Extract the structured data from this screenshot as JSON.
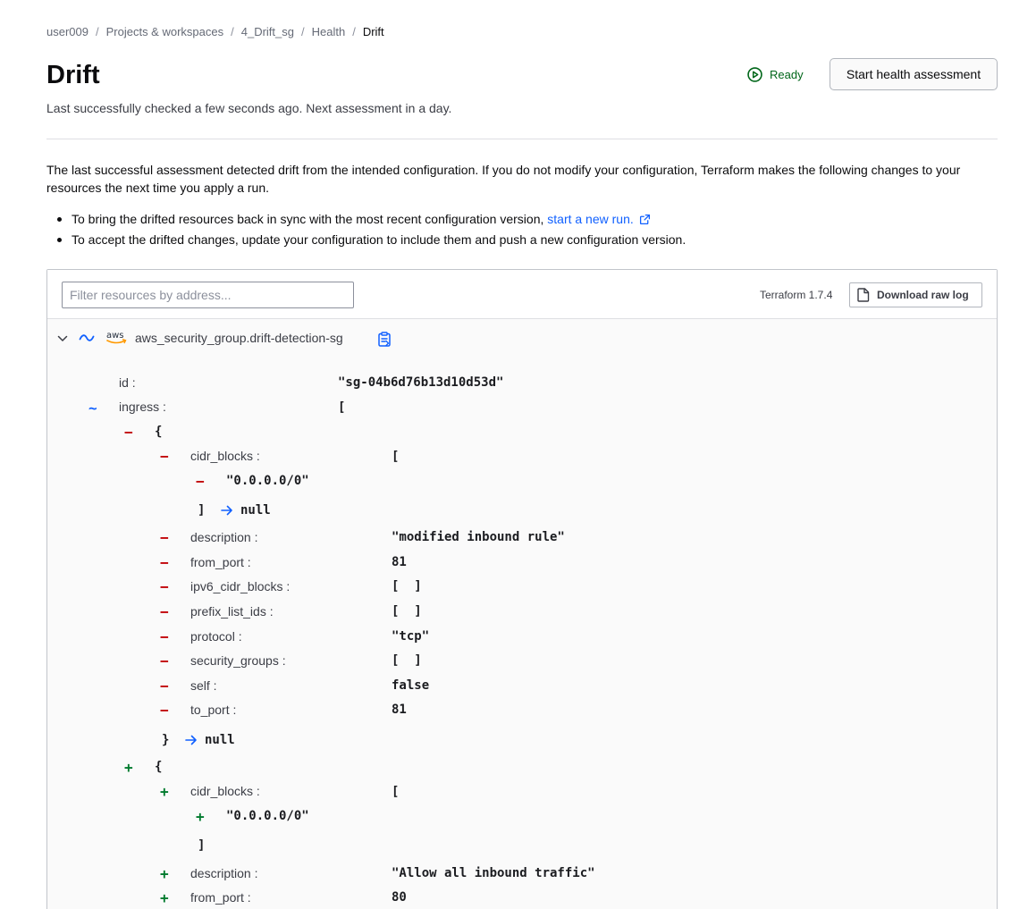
{
  "breadcrumb": {
    "items": [
      "user009",
      "Projects & workspaces",
      "4_Drift_sg",
      "Health",
      "Drift"
    ],
    "separator": "/"
  },
  "header": {
    "title": "Drift",
    "subtitle": "Last successfully checked a few seconds ago. Next assessment in a day.",
    "status_label": "Ready",
    "status_icon": "play-circle-icon",
    "start_button": "Start health assessment"
  },
  "intro": {
    "text": "The last successful assessment detected drift from the intended configuration. If you do not modify your configuration, Terraform makes the following changes to your resources the next time you apply a run.",
    "bullet1_text": "To bring the drifted resources back in sync with the most recent configuration version, ",
    "bullet1_link": "start a new run.",
    "bullet2_text": "To accept the drifted changes, update your configuration to include them and push a new configuration version."
  },
  "panel": {
    "filter_placeholder": "Filter resources by address...",
    "terraform_version": "Terraform 1.7.4",
    "download_button": "Download raw log",
    "resource": {
      "name": "aws_security_group.drift-detection-sg",
      "provider": "aws",
      "change_symbol": "~"
    }
  },
  "diff": {
    "id_key": "id :",
    "id_val": "\"sg-04b6d76b13d10d53d\"",
    "ingress_key": "ingress :",
    "open_bracket": "[",
    "close_bracket": "]",
    "open_brace": "{",
    "close_brace": "}",
    "empty_list": "[  ]",
    "null": "null",
    "minus": "−",
    "plus": "+",
    "tilde": "~",
    "removed": {
      "cidr_key": "cidr_blocks :",
      "cidr_item": "\"0.0.0.0/0\"",
      "description_key": "description :",
      "description_val": "\"modified inbound rule\"",
      "from_port_key": "from_port :",
      "from_port_val": "81",
      "ipv6_key": "ipv6_cidr_blocks :",
      "prefix_key": "prefix_list_ids :",
      "protocol_key": "protocol :",
      "protocol_val": "\"tcp\"",
      "sg_key": "security_groups :",
      "self_key": "self :",
      "self_val": "false",
      "to_port_key": "to_port :",
      "to_port_val": "81"
    },
    "added": {
      "cidr_key": "cidr_blocks :",
      "cidr_item": "\"0.0.0.0/0\"",
      "description_key": "description :",
      "description_val": "\"Allow all inbound traffic\"",
      "from_port_key": "from_port :",
      "from_port_val": "80"
    }
  },
  "colors": {
    "accent_blue": "#1060ff",
    "removed_red": "#c00005",
    "added_green": "#007a2d",
    "ready_green": "#006619"
  }
}
